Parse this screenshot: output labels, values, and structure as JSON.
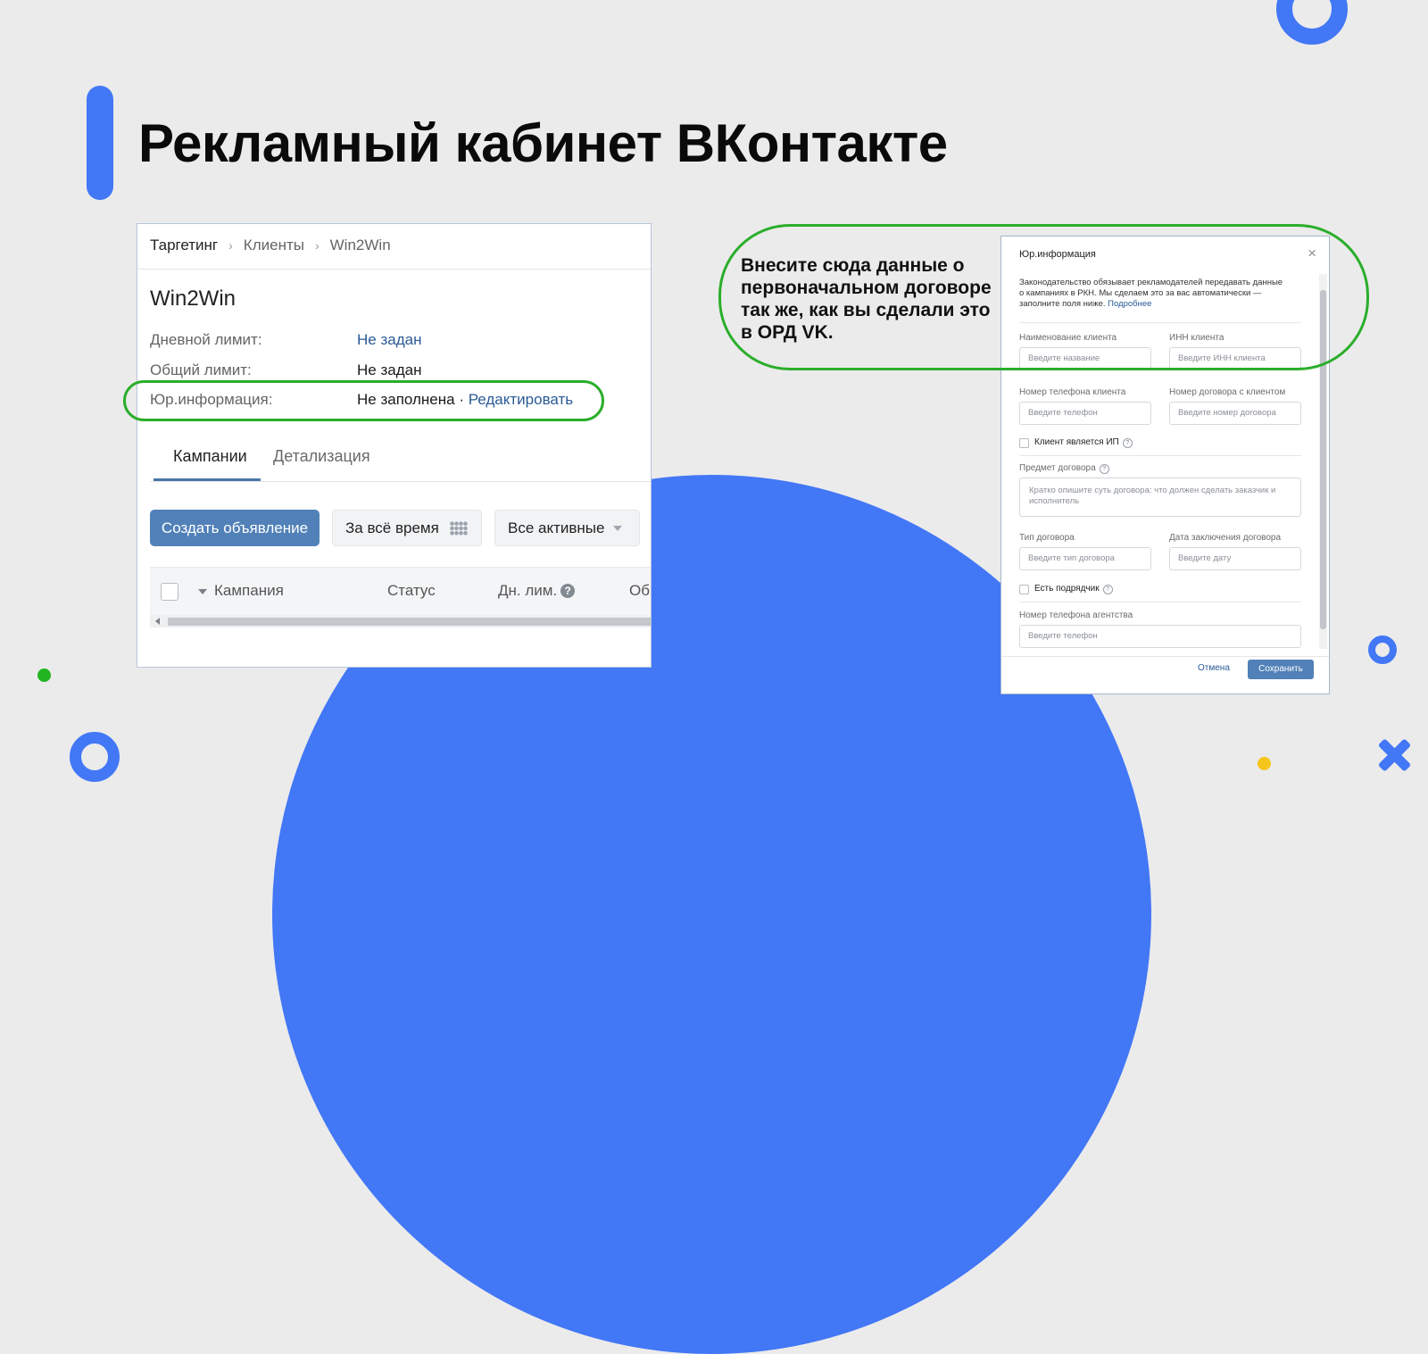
{
  "slide": {
    "title": "Рекламный кабинет ВКонтакте",
    "annotation": "Внесите сюда данные о первоначальном договоре так же, как вы сделали это в ОРД VK.",
    "colors": {
      "accent": "#4277f6",
      "highlight": "#2bae2b",
      "background": "#ebebeb"
    }
  },
  "vk": {
    "breadcrumbs": [
      "Таргетинг",
      "Клиенты",
      "Win2Win"
    ],
    "breadcrumb_separator": "›",
    "client_name": "Win2Win",
    "rows": [
      {
        "label": "Дневной лимит:",
        "value": "Не задан"
      },
      {
        "label": "Общий лимит:",
        "value": "Не задан"
      },
      {
        "label": "Юр.информация:",
        "value": "Не заполнена",
        "link_sep": " · ",
        "link": "Редактировать"
      }
    ],
    "tabs": [
      "Кампании",
      "Детализация"
    ],
    "create_button": "Создать объявление",
    "period_button": "За всё время",
    "filter_select": "Все активные",
    "columns": [
      "Кампания",
      "Статус",
      "Дн. лим.",
      "Об"
    ],
    "help_glyph": "?"
  },
  "modal": {
    "title": "Юр.информация",
    "close_glyph": "×",
    "intro": "Законодательство обязывает рекламодателей передавать данные о кампаниях в РКН. Мы сделаем это за вас автоматически — заполните поля ниже.",
    "intro_link": "Подробнее",
    "client_name_label": "Наименование клиента",
    "client_name_placeholder": "Введите название",
    "inn_label": "ИНН клиента",
    "inn_placeholder": "Введите ИНН клиента",
    "phone_label": "Номер телефона клиента",
    "phone_placeholder": "Введите телефон",
    "contract_number_label": "Номер договора с клиентом",
    "contract_number_placeholder": "Введите номер договора",
    "ip_checkbox": "Клиент является ИП",
    "subject_label": "Предмет договора",
    "subject_placeholder": "Кратко опишите суть договора: что должен сделать заказчик и исполнитель",
    "contract_type_label": "Тип договора",
    "contract_type_placeholder": "Введите тип договора",
    "contract_date_label": "Дата заключения договора",
    "contract_date_placeholder": "Введите дату",
    "contractor_checkbox": "Есть подрядчик",
    "agency_phone_label": "Номер телефона агентства",
    "agency_phone_placeholder": "Введите телефон",
    "cancel": "Отмена",
    "save": "Сохранить",
    "help_glyph": "?"
  }
}
